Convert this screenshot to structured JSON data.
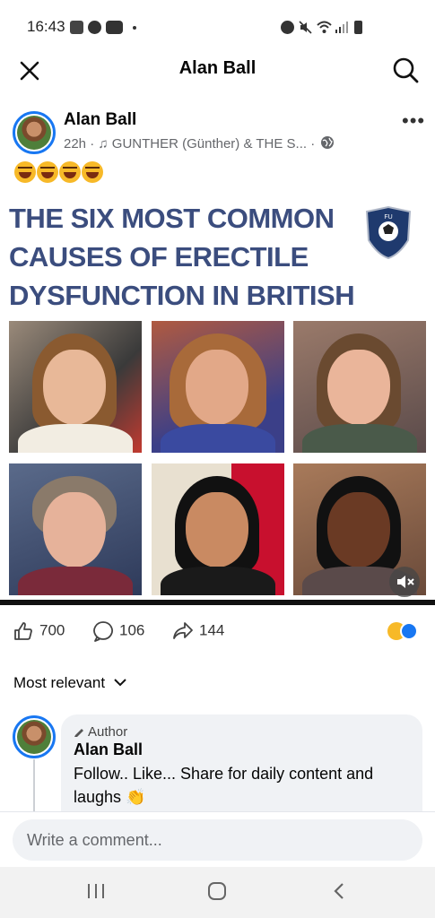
{
  "status_bar": {
    "time": "16:43",
    "left_icons": [
      "gallery-icon",
      "whatsapp-icon",
      "youtube-icon",
      "dot-icon"
    ],
    "right_icons": [
      "alarm-icon",
      "mute-icon",
      "wifi-icon",
      "signal-icon",
      "battery-icon"
    ]
  },
  "topbar": {
    "title": "Alan Ball",
    "close_icon": "close-icon",
    "search_icon": "search-icon"
  },
  "post": {
    "author": "Alan Ball",
    "meta": "22h · ♫ GUNTHER (Günther) & THE S... ·",
    "privacy_icon": "globe-icon",
    "caption_emoji": "😂😂😂😂",
    "image": {
      "title": "THE SIX MOST COMMON CAUSES OF ERECTILE DYSFUNCTION IN BRITISH MEN",
      "badge_text": "FU",
      "mute_icon": "speaker-muted-icon"
    },
    "reactions": {
      "likes": "700",
      "comments": "106",
      "shares": "144"
    }
  },
  "sort": {
    "label": "Most relevant"
  },
  "comment": {
    "badge": "Author",
    "name": "Alan Ball",
    "text": "Follow.. Like... Share for daily content and laughs 👏"
  },
  "composer": {
    "placeholder": "Write a comment..."
  },
  "nav": {
    "icons": [
      "recent-apps-icon",
      "home-icon",
      "back-icon"
    ]
  }
}
